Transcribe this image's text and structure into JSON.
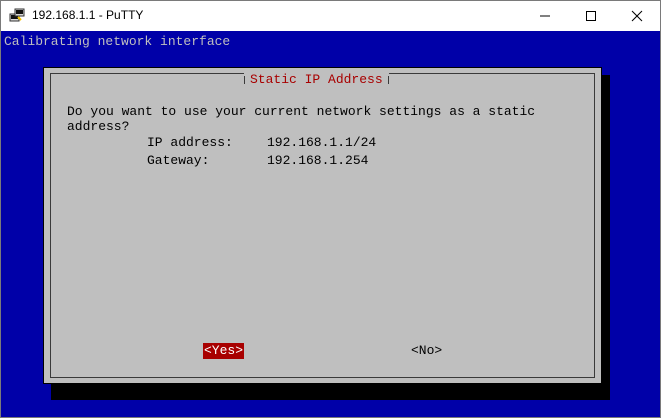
{
  "window": {
    "title": "192.168.1.1 - PuTTY",
    "icons": {
      "app": "putty-icon",
      "minimize": "minimize-icon",
      "maximize": "maximize-icon",
      "close": "close-icon"
    }
  },
  "terminal": {
    "status_line": "Calibrating network interface",
    "background_color": "#0000a8"
  },
  "dialog": {
    "title": "Static IP Address",
    "message_line1": "Do you want to use your current network settings as a static",
    "message_line2": "address?",
    "ip_label": "IP address:",
    "ip_value": "192.168.1.1/24",
    "gateway_label": "Gateway:",
    "gateway_value": "192.168.1.254",
    "yes_label": "<Yes>",
    "no_label": "<No>",
    "colors": {
      "dialog_bg": "#bfbfbf",
      "title": "#a80000",
      "selected_button_bg": "#a80000"
    }
  }
}
